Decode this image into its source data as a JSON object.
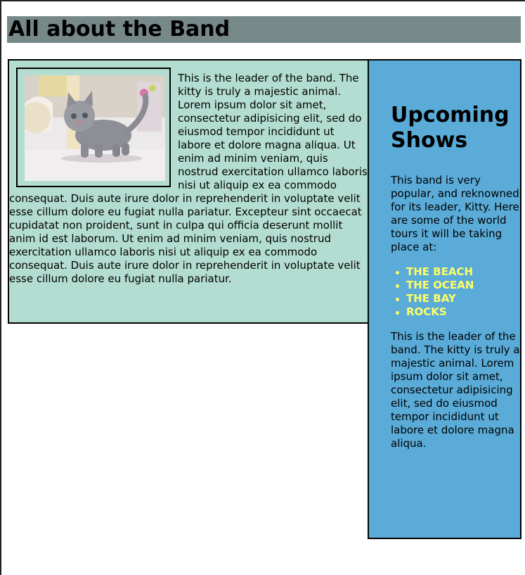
{
  "header": {
    "title": "All about the Band"
  },
  "main": {
    "image_alt": "kitten",
    "paragraph": "This is the leader of the band. The kitty is truly a majestic animal. Lorem ipsum dolor sit amet, consectetur adipisicing elit, sed do eiusmod tempor incididunt ut labore et dolore magna aliqua. Ut enim ad minim veniam, quis nostrud exercitation ullamco laboris nisi ut aliquip ex ea commodo consequat. Duis aute irure dolor in reprehenderit in voluptate velit esse cillum dolore eu fugiat nulla pariatur. Excepteur sint occaecat cupidatat non proident, sunt in culpa qui officia deserunt mollit anim id est laborum. Ut enim ad minim veniam, quis nostrud exercitation ullamco laboris nisi ut aliquip ex ea commodo consequat. Duis aute irure dolor in reprehenderit in voluptate velit esse cillum dolore eu fugiat nulla pariatur."
  },
  "sidebar": {
    "heading": "Upcoming Shows",
    "intro": "This band is very popular, and reknowned for its leader, Kitty. Here are some of the world tours it will be taking place at:",
    "shows": [
      "THE BEACH",
      "THE OCEAN",
      "THE BAY",
      "ROCKS"
    ],
    "outro": "This is the leader of the band. The kitty is truly a majestic animal. Lorem ipsum dolor sit amet, consectetur adipisicing elit, sed do eiusmod tempor incididunt ut labore et dolore magna aliqua."
  },
  "colors": {
    "header_bg": "#778888",
    "main_bg": "#b4ddd1",
    "sidebar_bg": "#5aabd8",
    "show_text": "#ffff66"
  }
}
